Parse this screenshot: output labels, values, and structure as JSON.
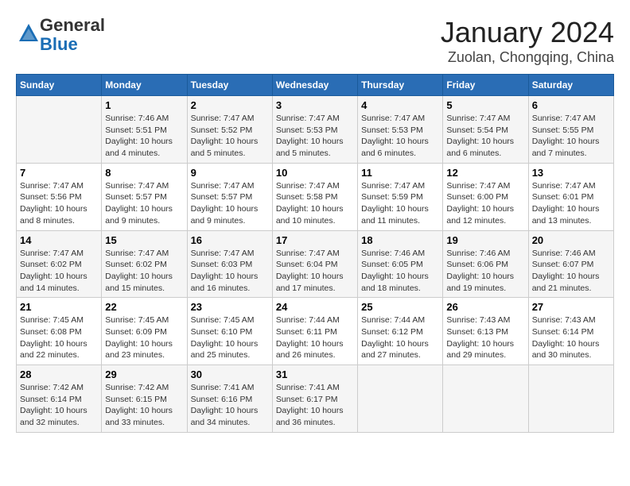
{
  "header": {
    "logo_line1": "General",
    "logo_line2": "Blue",
    "title": "January 2024",
    "subtitle": "Zuolan, Chongqing, China"
  },
  "columns": [
    "Sunday",
    "Monday",
    "Tuesday",
    "Wednesday",
    "Thursday",
    "Friday",
    "Saturday"
  ],
  "weeks": [
    [
      {
        "day": "",
        "sunrise": "",
        "sunset": "",
        "daylight": ""
      },
      {
        "day": "1",
        "sunrise": "Sunrise: 7:46 AM",
        "sunset": "Sunset: 5:51 PM",
        "daylight": "Daylight: 10 hours and 4 minutes."
      },
      {
        "day": "2",
        "sunrise": "Sunrise: 7:47 AM",
        "sunset": "Sunset: 5:52 PM",
        "daylight": "Daylight: 10 hours and 5 minutes."
      },
      {
        "day": "3",
        "sunrise": "Sunrise: 7:47 AM",
        "sunset": "Sunset: 5:53 PM",
        "daylight": "Daylight: 10 hours and 5 minutes."
      },
      {
        "day": "4",
        "sunrise": "Sunrise: 7:47 AM",
        "sunset": "Sunset: 5:53 PM",
        "daylight": "Daylight: 10 hours and 6 minutes."
      },
      {
        "day": "5",
        "sunrise": "Sunrise: 7:47 AM",
        "sunset": "Sunset: 5:54 PM",
        "daylight": "Daylight: 10 hours and 6 minutes."
      },
      {
        "day": "6",
        "sunrise": "Sunrise: 7:47 AM",
        "sunset": "Sunset: 5:55 PM",
        "daylight": "Daylight: 10 hours and 7 minutes."
      }
    ],
    [
      {
        "day": "7",
        "sunrise": "Sunrise: 7:47 AM",
        "sunset": "Sunset: 5:56 PM",
        "daylight": "Daylight: 10 hours and 8 minutes."
      },
      {
        "day": "8",
        "sunrise": "Sunrise: 7:47 AM",
        "sunset": "Sunset: 5:57 PM",
        "daylight": "Daylight: 10 hours and 9 minutes."
      },
      {
        "day": "9",
        "sunrise": "Sunrise: 7:47 AM",
        "sunset": "Sunset: 5:57 PM",
        "daylight": "Daylight: 10 hours and 9 minutes."
      },
      {
        "day": "10",
        "sunrise": "Sunrise: 7:47 AM",
        "sunset": "Sunset: 5:58 PM",
        "daylight": "Daylight: 10 hours and 10 minutes."
      },
      {
        "day": "11",
        "sunrise": "Sunrise: 7:47 AM",
        "sunset": "Sunset: 5:59 PM",
        "daylight": "Daylight: 10 hours and 11 minutes."
      },
      {
        "day": "12",
        "sunrise": "Sunrise: 7:47 AM",
        "sunset": "Sunset: 6:00 PM",
        "daylight": "Daylight: 10 hours and 12 minutes."
      },
      {
        "day": "13",
        "sunrise": "Sunrise: 7:47 AM",
        "sunset": "Sunset: 6:01 PM",
        "daylight": "Daylight: 10 hours and 13 minutes."
      }
    ],
    [
      {
        "day": "14",
        "sunrise": "Sunrise: 7:47 AM",
        "sunset": "Sunset: 6:02 PM",
        "daylight": "Daylight: 10 hours and 14 minutes."
      },
      {
        "day": "15",
        "sunrise": "Sunrise: 7:47 AM",
        "sunset": "Sunset: 6:02 PM",
        "daylight": "Daylight: 10 hours and 15 minutes."
      },
      {
        "day": "16",
        "sunrise": "Sunrise: 7:47 AM",
        "sunset": "Sunset: 6:03 PM",
        "daylight": "Daylight: 10 hours and 16 minutes."
      },
      {
        "day": "17",
        "sunrise": "Sunrise: 7:47 AM",
        "sunset": "Sunset: 6:04 PM",
        "daylight": "Daylight: 10 hours and 17 minutes."
      },
      {
        "day": "18",
        "sunrise": "Sunrise: 7:46 AM",
        "sunset": "Sunset: 6:05 PM",
        "daylight": "Daylight: 10 hours and 18 minutes."
      },
      {
        "day": "19",
        "sunrise": "Sunrise: 7:46 AM",
        "sunset": "Sunset: 6:06 PM",
        "daylight": "Daylight: 10 hours and 19 minutes."
      },
      {
        "day": "20",
        "sunrise": "Sunrise: 7:46 AM",
        "sunset": "Sunset: 6:07 PM",
        "daylight": "Daylight: 10 hours and 21 minutes."
      }
    ],
    [
      {
        "day": "21",
        "sunrise": "Sunrise: 7:45 AM",
        "sunset": "Sunset: 6:08 PM",
        "daylight": "Daylight: 10 hours and 22 minutes."
      },
      {
        "day": "22",
        "sunrise": "Sunrise: 7:45 AM",
        "sunset": "Sunset: 6:09 PM",
        "daylight": "Daylight: 10 hours and 23 minutes."
      },
      {
        "day": "23",
        "sunrise": "Sunrise: 7:45 AM",
        "sunset": "Sunset: 6:10 PM",
        "daylight": "Daylight: 10 hours and 25 minutes."
      },
      {
        "day": "24",
        "sunrise": "Sunrise: 7:44 AM",
        "sunset": "Sunset: 6:11 PM",
        "daylight": "Daylight: 10 hours and 26 minutes."
      },
      {
        "day": "25",
        "sunrise": "Sunrise: 7:44 AM",
        "sunset": "Sunset: 6:12 PM",
        "daylight": "Daylight: 10 hours and 27 minutes."
      },
      {
        "day": "26",
        "sunrise": "Sunrise: 7:43 AM",
        "sunset": "Sunset: 6:13 PM",
        "daylight": "Daylight: 10 hours and 29 minutes."
      },
      {
        "day": "27",
        "sunrise": "Sunrise: 7:43 AM",
        "sunset": "Sunset: 6:14 PM",
        "daylight": "Daylight: 10 hours and 30 minutes."
      }
    ],
    [
      {
        "day": "28",
        "sunrise": "Sunrise: 7:42 AM",
        "sunset": "Sunset: 6:14 PM",
        "daylight": "Daylight: 10 hours and 32 minutes."
      },
      {
        "day": "29",
        "sunrise": "Sunrise: 7:42 AM",
        "sunset": "Sunset: 6:15 PM",
        "daylight": "Daylight: 10 hours and 33 minutes."
      },
      {
        "day": "30",
        "sunrise": "Sunrise: 7:41 AM",
        "sunset": "Sunset: 6:16 PM",
        "daylight": "Daylight: 10 hours and 34 minutes."
      },
      {
        "day": "31",
        "sunrise": "Sunrise: 7:41 AM",
        "sunset": "Sunset: 6:17 PM",
        "daylight": "Daylight: 10 hours and 36 minutes."
      },
      {
        "day": "",
        "sunrise": "",
        "sunset": "",
        "daylight": ""
      },
      {
        "day": "",
        "sunrise": "",
        "sunset": "",
        "daylight": ""
      },
      {
        "day": "",
        "sunrise": "",
        "sunset": "",
        "daylight": ""
      }
    ]
  ]
}
